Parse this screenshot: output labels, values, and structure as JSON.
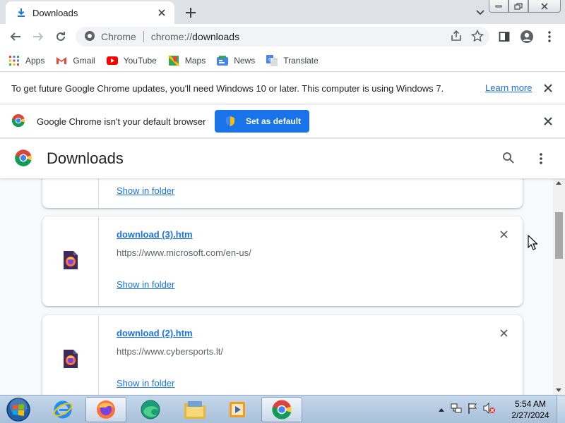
{
  "tab": {
    "title": "Downloads"
  },
  "omnibox": {
    "site_label": "Chrome",
    "url_scheme": "chrome://",
    "url_path": "downloads"
  },
  "bookmarks": [
    {
      "label": "Apps",
      "icon": "apps-grid-icon"
    },
    {
      "label": "Gmail",
      "icon": "gmail-icon"
    },
    {
      "label": "YouTube",
      "icon": "youtube-icon"
    },
    {
      "label": "Maps",
      "icon": "maps-icon"
    },
    {
      "label": "News",
      "icon": "news-icon"
    },
    {
      "label": "Translate",
      "icon": "translate-icon"
    }
  ],
  "infobar_update": {
    "message": "To get future Google Chrome updates, you'll need Windows 10 or later. This computer is using Windows 7.",
    "link": "Learn more"
  },
  "infobar_default": {
    "message": "Google Chrome isn't your default browser",
    "button": "Set as default"
  },
  "page": {
    "title": "Downloads"
  },
  "downloads": [
    {
      "filename": "",
      "url": "",
      "action": "Show in folder"
    },
    {
      "filename": "download (3).htm",
      "url": "https://www.microsoft.com/en-us/",
      "action": "Show in folder"
    },
    {
      "filename": "download (2).htm",
      "url": "https://www.cybersports.lt/",
      "action": "Show in folder"
    }
  ],
  "taskbar": {
    "clock_time": "5:54 AM",
    "clock_date": "2/27/2024",
    "apps": [
      "internet-explorer-icon",
      "firefox-icon",
      "edge-icon",
      "file-explorer-icon",
      "media-player-icon",
      "chrome-icon"
    ]
  },
  "colors": {
    "accent": "#1a73e8",
    "tabstrip": "#dee1e6",
    "page_bg": "#f8f9fa"
  }
}
